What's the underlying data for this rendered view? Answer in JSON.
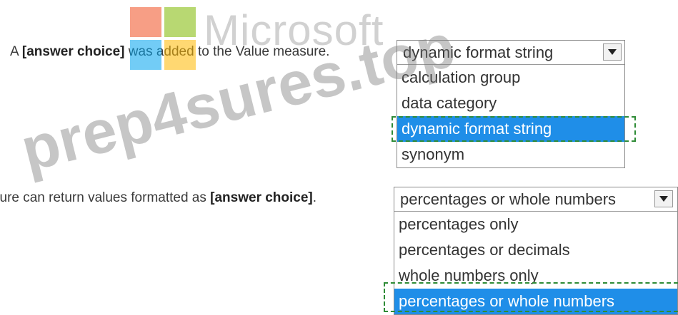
{
  "question": {
    "statement1": {
      "before": "A ",
      "placeholder": "[answer choice]",
      "after": " was added to the Value measure."
    },
    "statement2": {
      "before": "sure can return values formatted as ",
      "placeholder": "[answer choice]",
      "after": "."
    }
  },
  "dropdown1": {
    "selected": "dynamic format string",
    "options": [
      "calculation group",
      "data category",
      "dynamic format string",
      "synonym"
    ],
    "highlighted_index": 2
  },
  "dropdown2": {
    "selected": "percentages or whole numbers",
    "options": [
      "percentages only",
      "percentages or decimals",
      "whole numbers only",
      "percentages or whole numbers"
    ],
    "highlighted_index": 3
  },
  "watermark": {
    "logo_text": "Microsoft",
    "site_text": "prep4sures.top"
  },
  "colors": {
    "selection": "#1f8ee8",
    "highlight_border": "#2e8b36"
  }
}
